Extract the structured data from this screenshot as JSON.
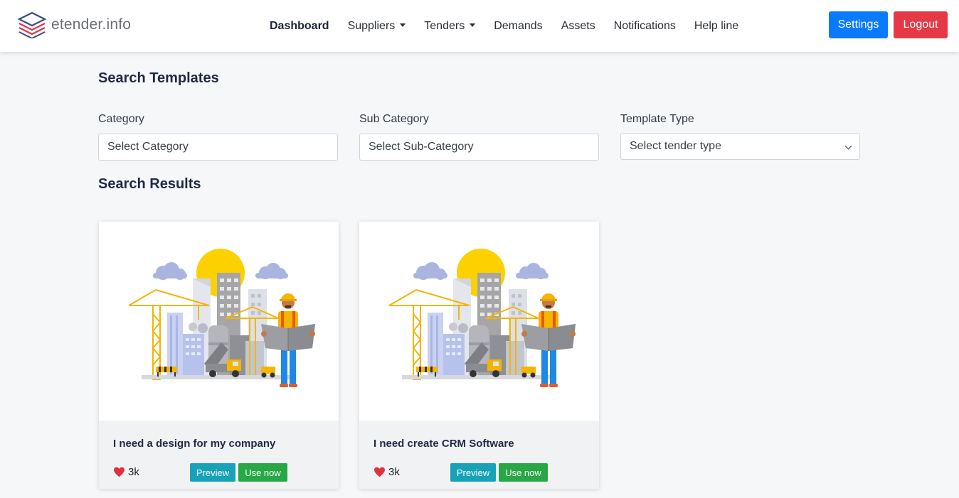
{
  "brand": {
    "name": "etender.info"
  },
  "nav": {
    "items": [
      {
        "label": "Dashboard",
        "active": true,
        "dropdown": false
      },
      {
        "label": "Suppliers",
        "active": false,
        "dropdown": true
      },
      {
        "label": "Tenders",
        "active": false,
        "dropdown": true
      },
      {
        "label": "Demands",
        "active": false,
        "dropdown": false
      },
      {
        "label": "Assets",
        "active": false,
        "dropdown": false
      },
      {
        "label": "Notifications",
        "active": false,
        "dropdown": false
      },
      {
        "label": "Help line",
        "active": false,
        "dropdown": false
      }
    ],
    "settings_label": "Settings",
    "logout_label": "Logout"
  },
  "search": {
    "title": "Search Templates",
    "category": {
      "label": "Category",
      "value": "Select Category"
    },
    "sub_category": {
      "label": "Sub Category",
      "value": "Select Sub-Category"
    },
    "template_type": {
      "label": "Template Type",
      "value": "Select tender type"
    }
  },
  "results": {
    "title": "Search Results",
    "cards": [
      {
        "title": "I need a design for my company",
        "likes": "3k",
        "preview_label": "Preview",
        "use_label": "Use now",
        "image_icon": "construction-illustration"
      },
      {
        "title": "I need create CRM Software",
        "likes": "3k",
        "preview_label": "Preview",
        "use_label": "Use now",
        "image_icon": "construction-illustration"
      }
    ]
  },
  "colors": {
    "primary": "#0a7bff",
    "danger": "#e63946",
    "info": "#17a2b8",
    "success": "#28a745",
    "heart": "#e0303f"
  }
}
